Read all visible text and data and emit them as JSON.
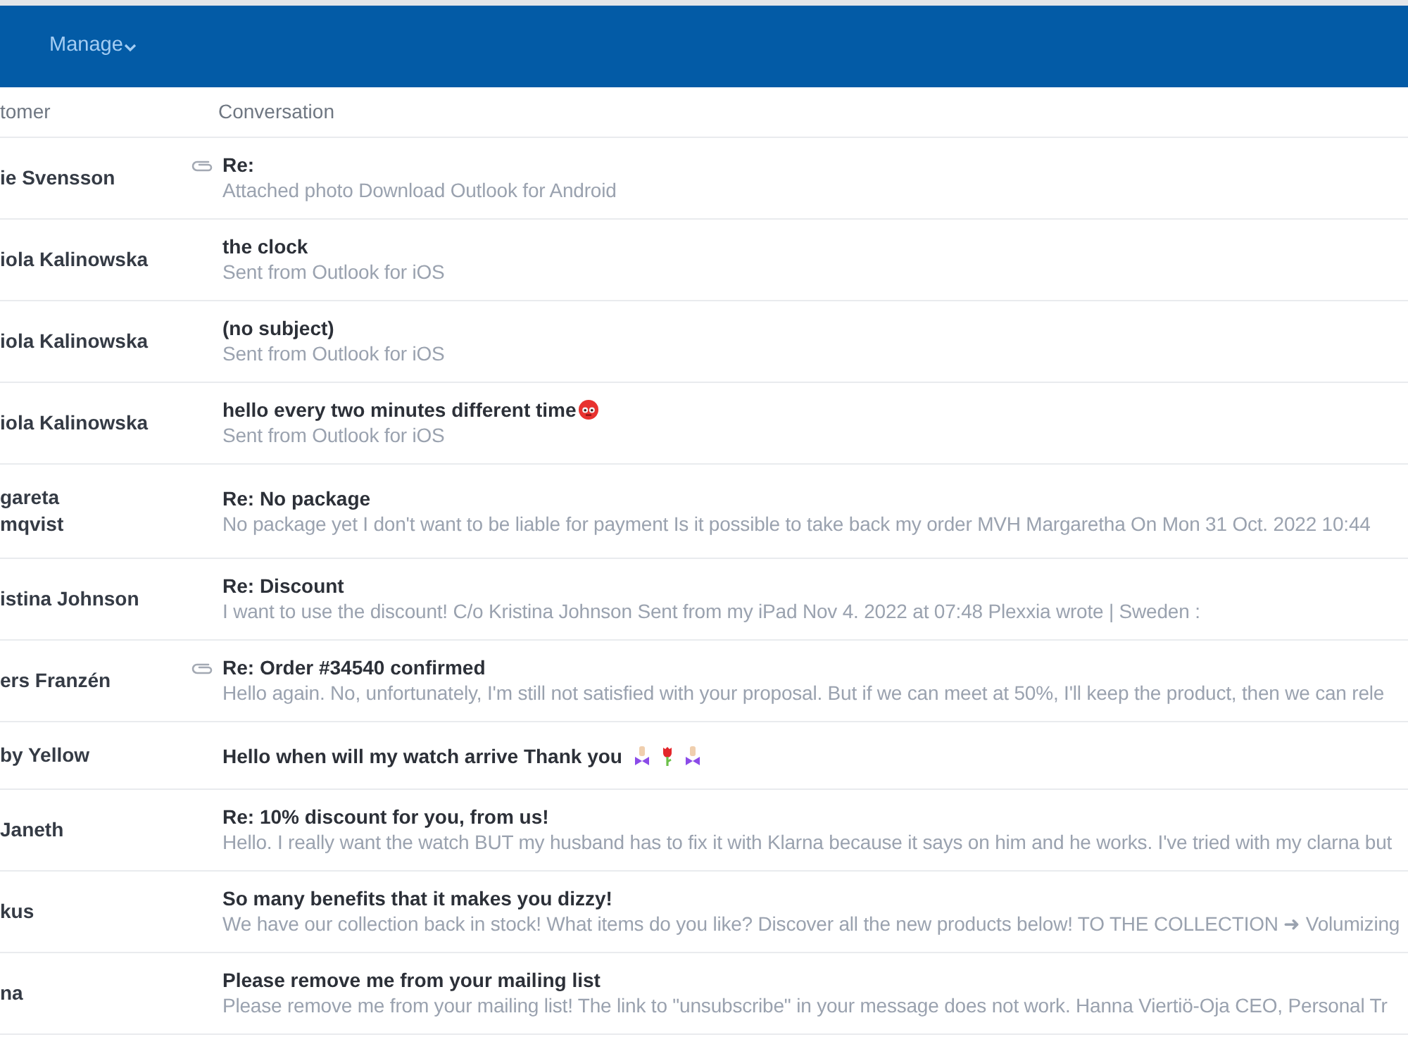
{
  "top_bar": {
    "nav": [
      {
        "label": "Manage",
        "dropdown": true
      }
    ]
  },
  "table": {
    "columns": [
      "tomer",
      "Conversation"
    ],
    "rows": [
      {
        "customer": "ie Svensson",
        "attachment": true,
        "subject": "Re:",
        "preview": "Attached photo Download Outlook for Android"
      },
      {
        "customer": "iola Kalinowska",
        "attachment": false,
        "subject": "the clock",
        "preview": "Sent from Outlook for iOS"
      },
      {
        "customer": "iola Kalinowska",
        "attachment": false,
        "subject": "(no subject)",
        "preview": "Sent from Outlook for iOS"
      },
      {
        "customer": "iola Kalinowska",
        "attachment": false,
        "subject": "hello every two minutes different time",
        "emoji": [
          {
            "kind": "face"
          }
        ],
        "preview": "Sent from Outlook for iOS"
      },
      {
        "customer": "gareta\nmqvist",
        "attachment": false,
        "subject": "Re: No package",
        "preview": "No package yet I don't want to be liable for payment Is it possible to take back my order MVH Margaretha On Mon 31 Oct. 2022 10:44"
      },
      {
        "customer": "istina Johnson",
        "attachment": false,
        "subject": "Re: Discount",
        "preview": "I want to use the discount! C/o Kristina Johnson Sent from my iPad Nov 4. 2022 at 07:48 Plexxia wrote | Sweden :"
      },
      {
        "customer": "ers Franzén",
        "attachment": true,
        "subject": "Re: Order #34540 confirmed",
        "preview": "Hello again. No, unfortunately, I'm still not satisfied with your proposal. But if we can meet at 50%, I'll keep the product, then we can rele"
      },
      {
        "customer": "by Yellow",
        "attachment": false,
        "subject": "Hello when will my watch arrive Thank you",
        "emoji": [
          {
            "kind": "figure"
          },
          {
            "kind": "rose"
          },
          {
            "kind": "figure"
          }
        ]
      },
      {
        "customer": "Janeth",
        "attachment": false,
        "subject": "Re: 10% discount for you, from us!",
        "preview": "Hello. I really want the watch BUT my husband has to fix it with Klarna because it says on him and he works. I've tried with my clarna but"
      },
      {
        "customer": "kus",
        "attachment": false,
        "subject": "So many benefits that it makes you dizzy!",
        "preview": "We have our collection back in stock! What items do you like? Discover all the new products below! TO THE COLLECTION ➜ Volumizing"
      },
      {
        "customer": "na",
        "attachment": false,
        "subject": "Please remove me from your mailing list",
        "preview": "Please remove me from your mailing list! The link to \"unsubscribe\" in your message does not work. Hanna Viertiö-Oja CEO, Personal Tr"
      }
    ]
  }
}
